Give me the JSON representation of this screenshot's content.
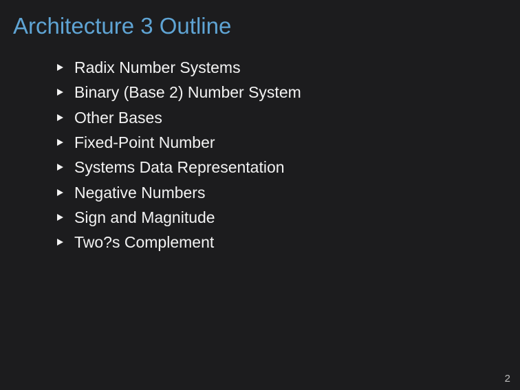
{
  "slide": {
    "title": "Architecture 3 Outline",
    "items": [
      {
        "label": "Radix Number Systems"
      },
      {
        "label": "Binary (Base 2) Number System"
      },
      {
        "label": "Other Bases"
      },
      {
        "label": "Fixed-Point Number"
      },
      {
        "label": "Systems Data Representation"
      },
      {
        "label": "Negative Numbers"
      },
      {
        "label": "Sign and Magnitude"
      },
      {
        "label": "Two?s Complement"
      }
    ],
    "page_number": "2"
  },
  "colors": {
    "background": "#1c1c1e",
    "title": "#5fa4d4",
    "text": "#f2f2f2"
  }
}
